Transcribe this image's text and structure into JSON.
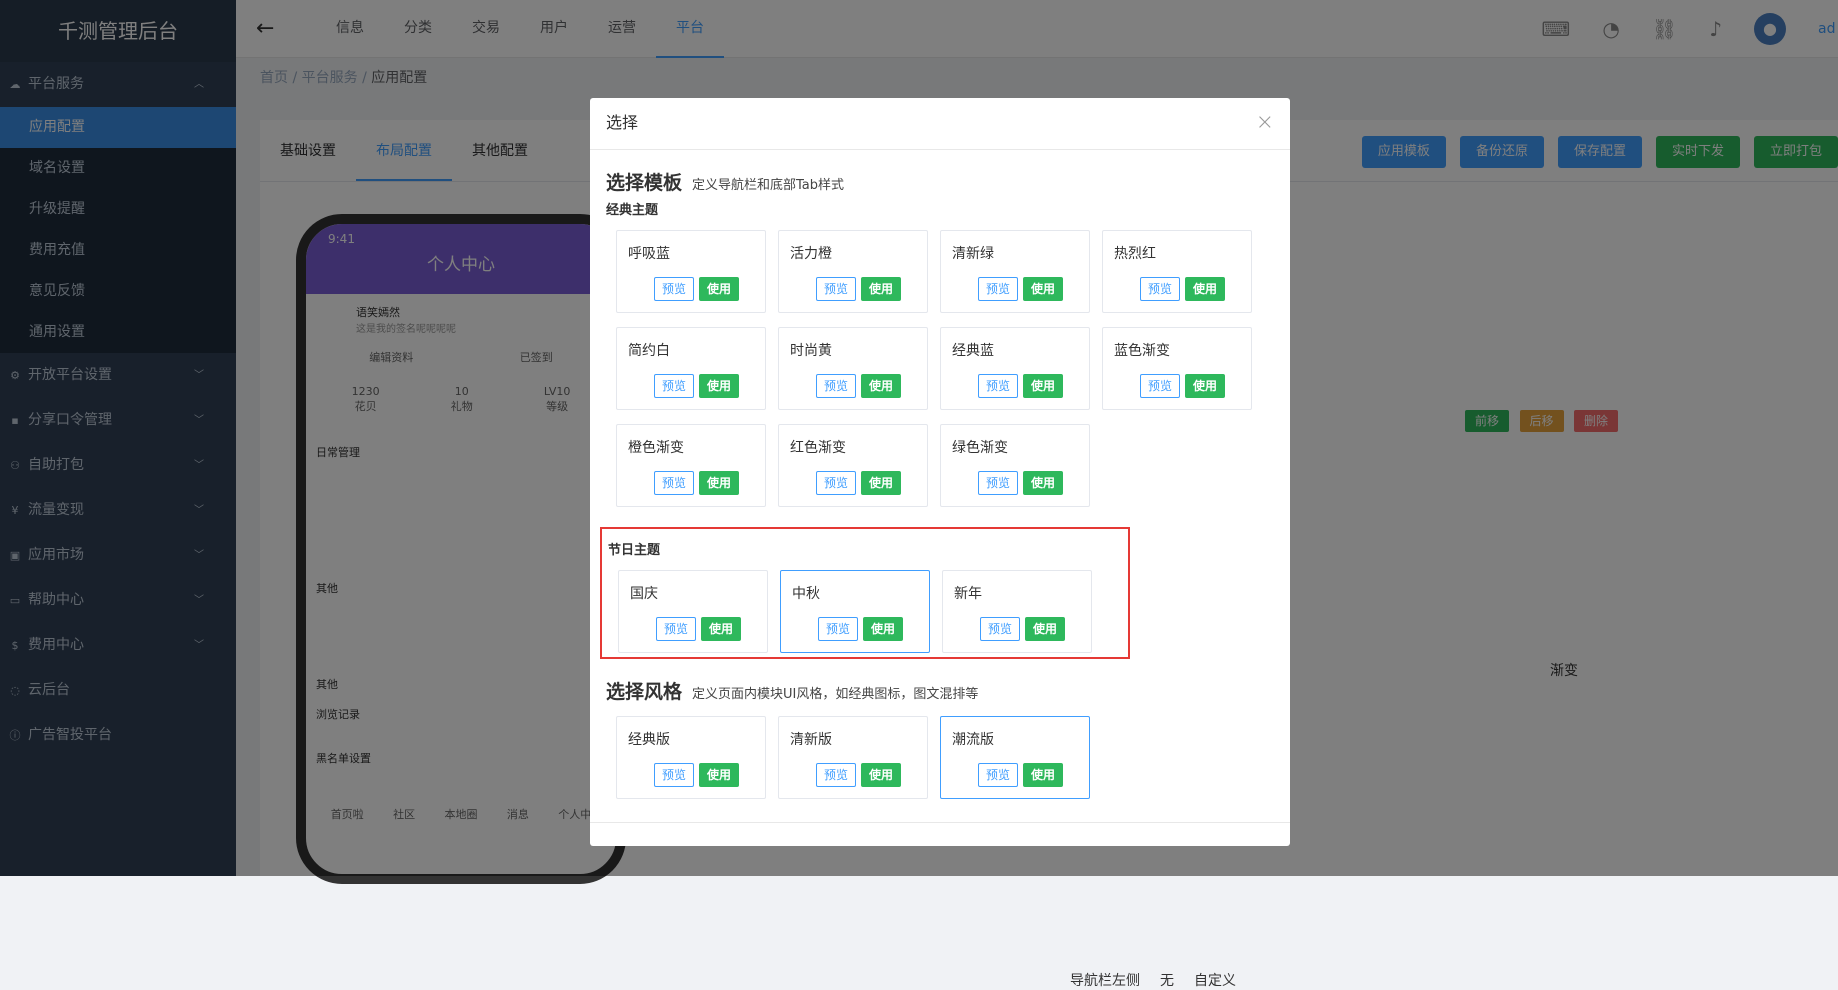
{
  "app": {
    "title": "千测管理后台"
  },
  "sidebar": {
    "group_open": "平台服务",
    "sub_items": [
      "应用配置",
      "域名设置",
      "升级提醒",
      "费用充值",
      "意见反馈",
      "通用设置"
    ],
    "groups": [
      "开放平台设置",
      "分享口令管理",
      "自助打包",
      "流量变现",
      "应用市场",
      "帮助中心",
      "费用中心"
    ],
    "links": [
      "云后台",
      "广告智投平台"
    ]
  },
  "topnav": {
    "back": "←",
    "tabs": [
      "信息",
      "分类",
      "交易",
      "用户",
      "运营",
      "平台"
    ],
    "user": "ad"
  },
  "breadcrumb": {
    "home": "首页",
    "sep": "/",
    "level2": "平台服务",
    "current": "应用配置"
  },
  "page": {
    "tabs": [
      "基础设置",
      "布局配置",
      "其他配置"
    ],
    "actions": [
      "应用模板",
      "备份还原",
      "保存配置",
      "实时下发",
      "立即打包"
    ],
    "phone": {
      "time": "9:41",
      "title": "个人中心",
      "user": "语笑嫣然",
      "sign": "这是我的签名呢呢呢呢",
      "edit": "编辑资料",
      "signed": "已签到",
      "stats": [
        {
          "v": "1230",
          "l": "花贝"
        },
        {
          "v": "10",
          "l": "礼物"
        },
        {
          "v": "LV10",
          "l": "等级"
        }
      ],
      "daily": "日常管理",
      "other1": "其他",
      "other2": "其他",
      "browse": "浏览记录",
      "blacklist": "黑名单设置",
      "bottom_tabs": [
        "首页啦",
        "社区",
        "本地圈",
        "消息",
        "个人中"
      ]
    },
    "move_buttons": [
      "前移",
      "后移",
      "删除"
    ],
    "bg_text": {
      "gradient": "渐变",
      "nav_left": "导航栏左侧",
      "none": "无",
      "custom": "自定义"
    }
  },
  "modal": {
    "title": "选择",
    "close": "×",
    "template": {
      "title": "选择模板",
      "desc": "定义导航栏和底部Tab样式",
      "classic_title": "经典主题",
      "classic": [
        "呼吸蓝",
        "活力橙",
        "清新绿",
        "热烈红",
        "简约白",
        "时尚黄",
        "经典蓝",
        "蓝色渐变",
        "橙色渐变",
        "红色渐变",
        "绿色渐变"
      ],
      "festival_title": "节日主题",
      "festival": [
        "国庆",
        "中秋",
        "新年"
      ]
    },
    "style": {
      "title": "选择风格",
      "desc": "定义页面内模块UI风格，如经典图标，图文混排等",
      "items": [
        "经典版",
        "清新版",
        "潮流版"
      ]
    },
    "preview_label": "预览",
    "use_label": "使用"
  },
  "colors": {
    "accent": "#409eff",
    "use": "#2eb85c",
    "highlight_border": "#e53935",
    "sidebar": "#304156"
  }
}
